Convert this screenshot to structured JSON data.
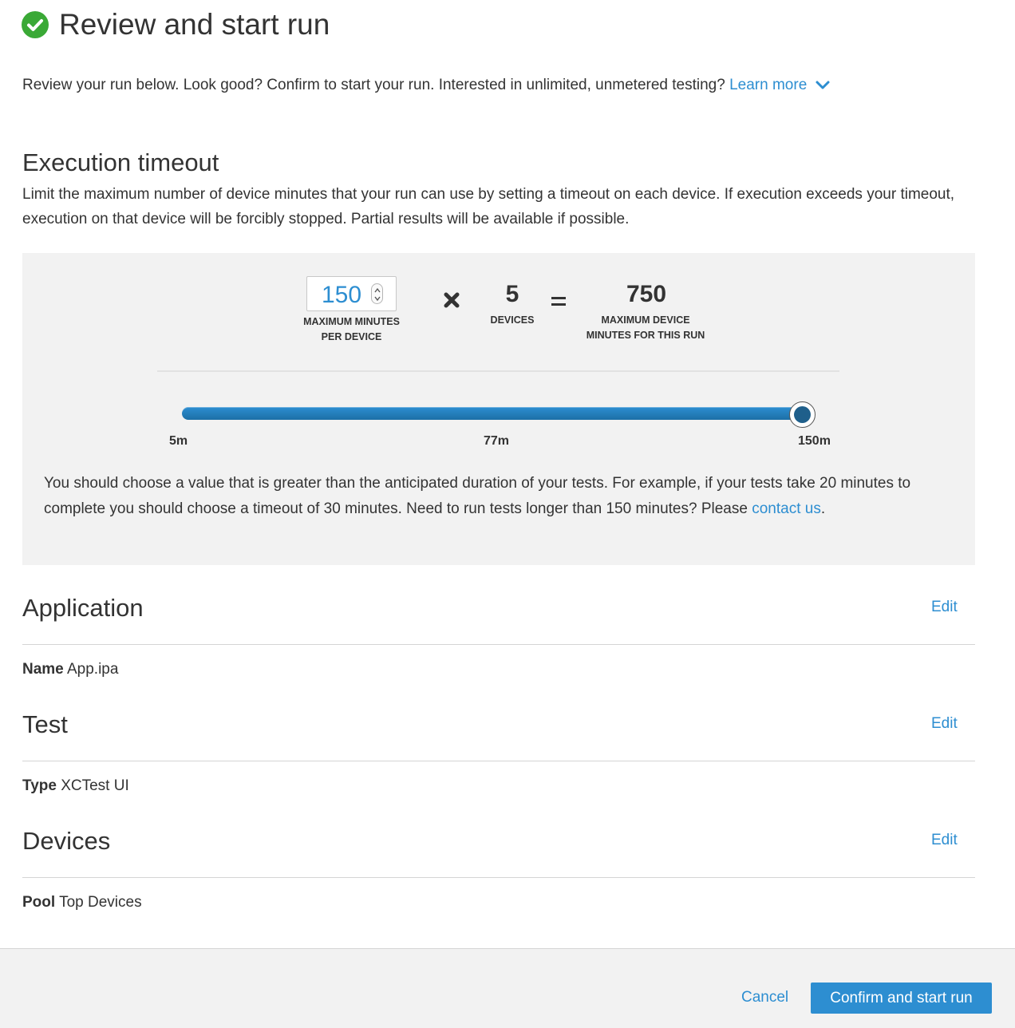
{
  "header": {
    "title": "Review and start run",
    "intro_text": "Review your run below. Look good? Confirm to start your run. Interested in unlimited, unmetered testing?",
    "learn_more": "Learn more",
    "status_color": "#3aa936",
    "icons": [
      "check-circle-icon",
      "chevron-down-icon"
    ]
  },
  "timeout": {
    "heading": "Execution timeout",
    "description": "Limit the maximum number of device minutes that your run can use by setting a timeout on each device. If execution exceeds your timeout, execution on that device will be forcibly stopped. Partial results will be available if possible.",
    "minutes_value": "150",
    "minutes_label_1": "MAXIMUM MINUTES",
    "minutes_label_2": "PER DEVICE",
    "devices_value": "5",
    "devices_label": "DEVICES",
    "total_value": "750",
    "total_label_1": "MAXIMUM DEVICE",
    "total_label_2": "MINUTES FOR THIS RUN",
    "slider": {
      "min_label": "5m",
      "mid_label": "77m",
      "max_label": "150m",
      "min": 5,
      "max": 150,
      "value": 150
    },
    "hint_text": "You should choose a value that is greater than the anticipated duration of your tests. For example, if your tests take 20 minutes to complete you should choose a timeout of 30 minutes. Need to run tests longer than 150 minutes? Please",
    "contact_link": "contact us",
    "hint_end": "."
  },
  "sections": {
    "application": {
      "heading": "Application",
      "edit": "Edit",
      "key": "Name",
      "value": "App.ipa"
    },
    "test": {
      "heading": "Test",
      "edit": "Edit",
      "key": "Type",
      "value": "XCTest UI"
    },
    "devices": {
      "heading": "Devices",
      "edit": "Edit",
      "key": "Pool",
      "value": "Top Devices"
    }
  },
  "footer": {
    "cancel": "Cancel",
    "confirm": "Confirm and start run"
  },
  "colors": {
    "accent": "#2d8ed1",
    "panel": "#f2f2f2",
    "slider_thumb": "#1f5f8b"
  }
}
